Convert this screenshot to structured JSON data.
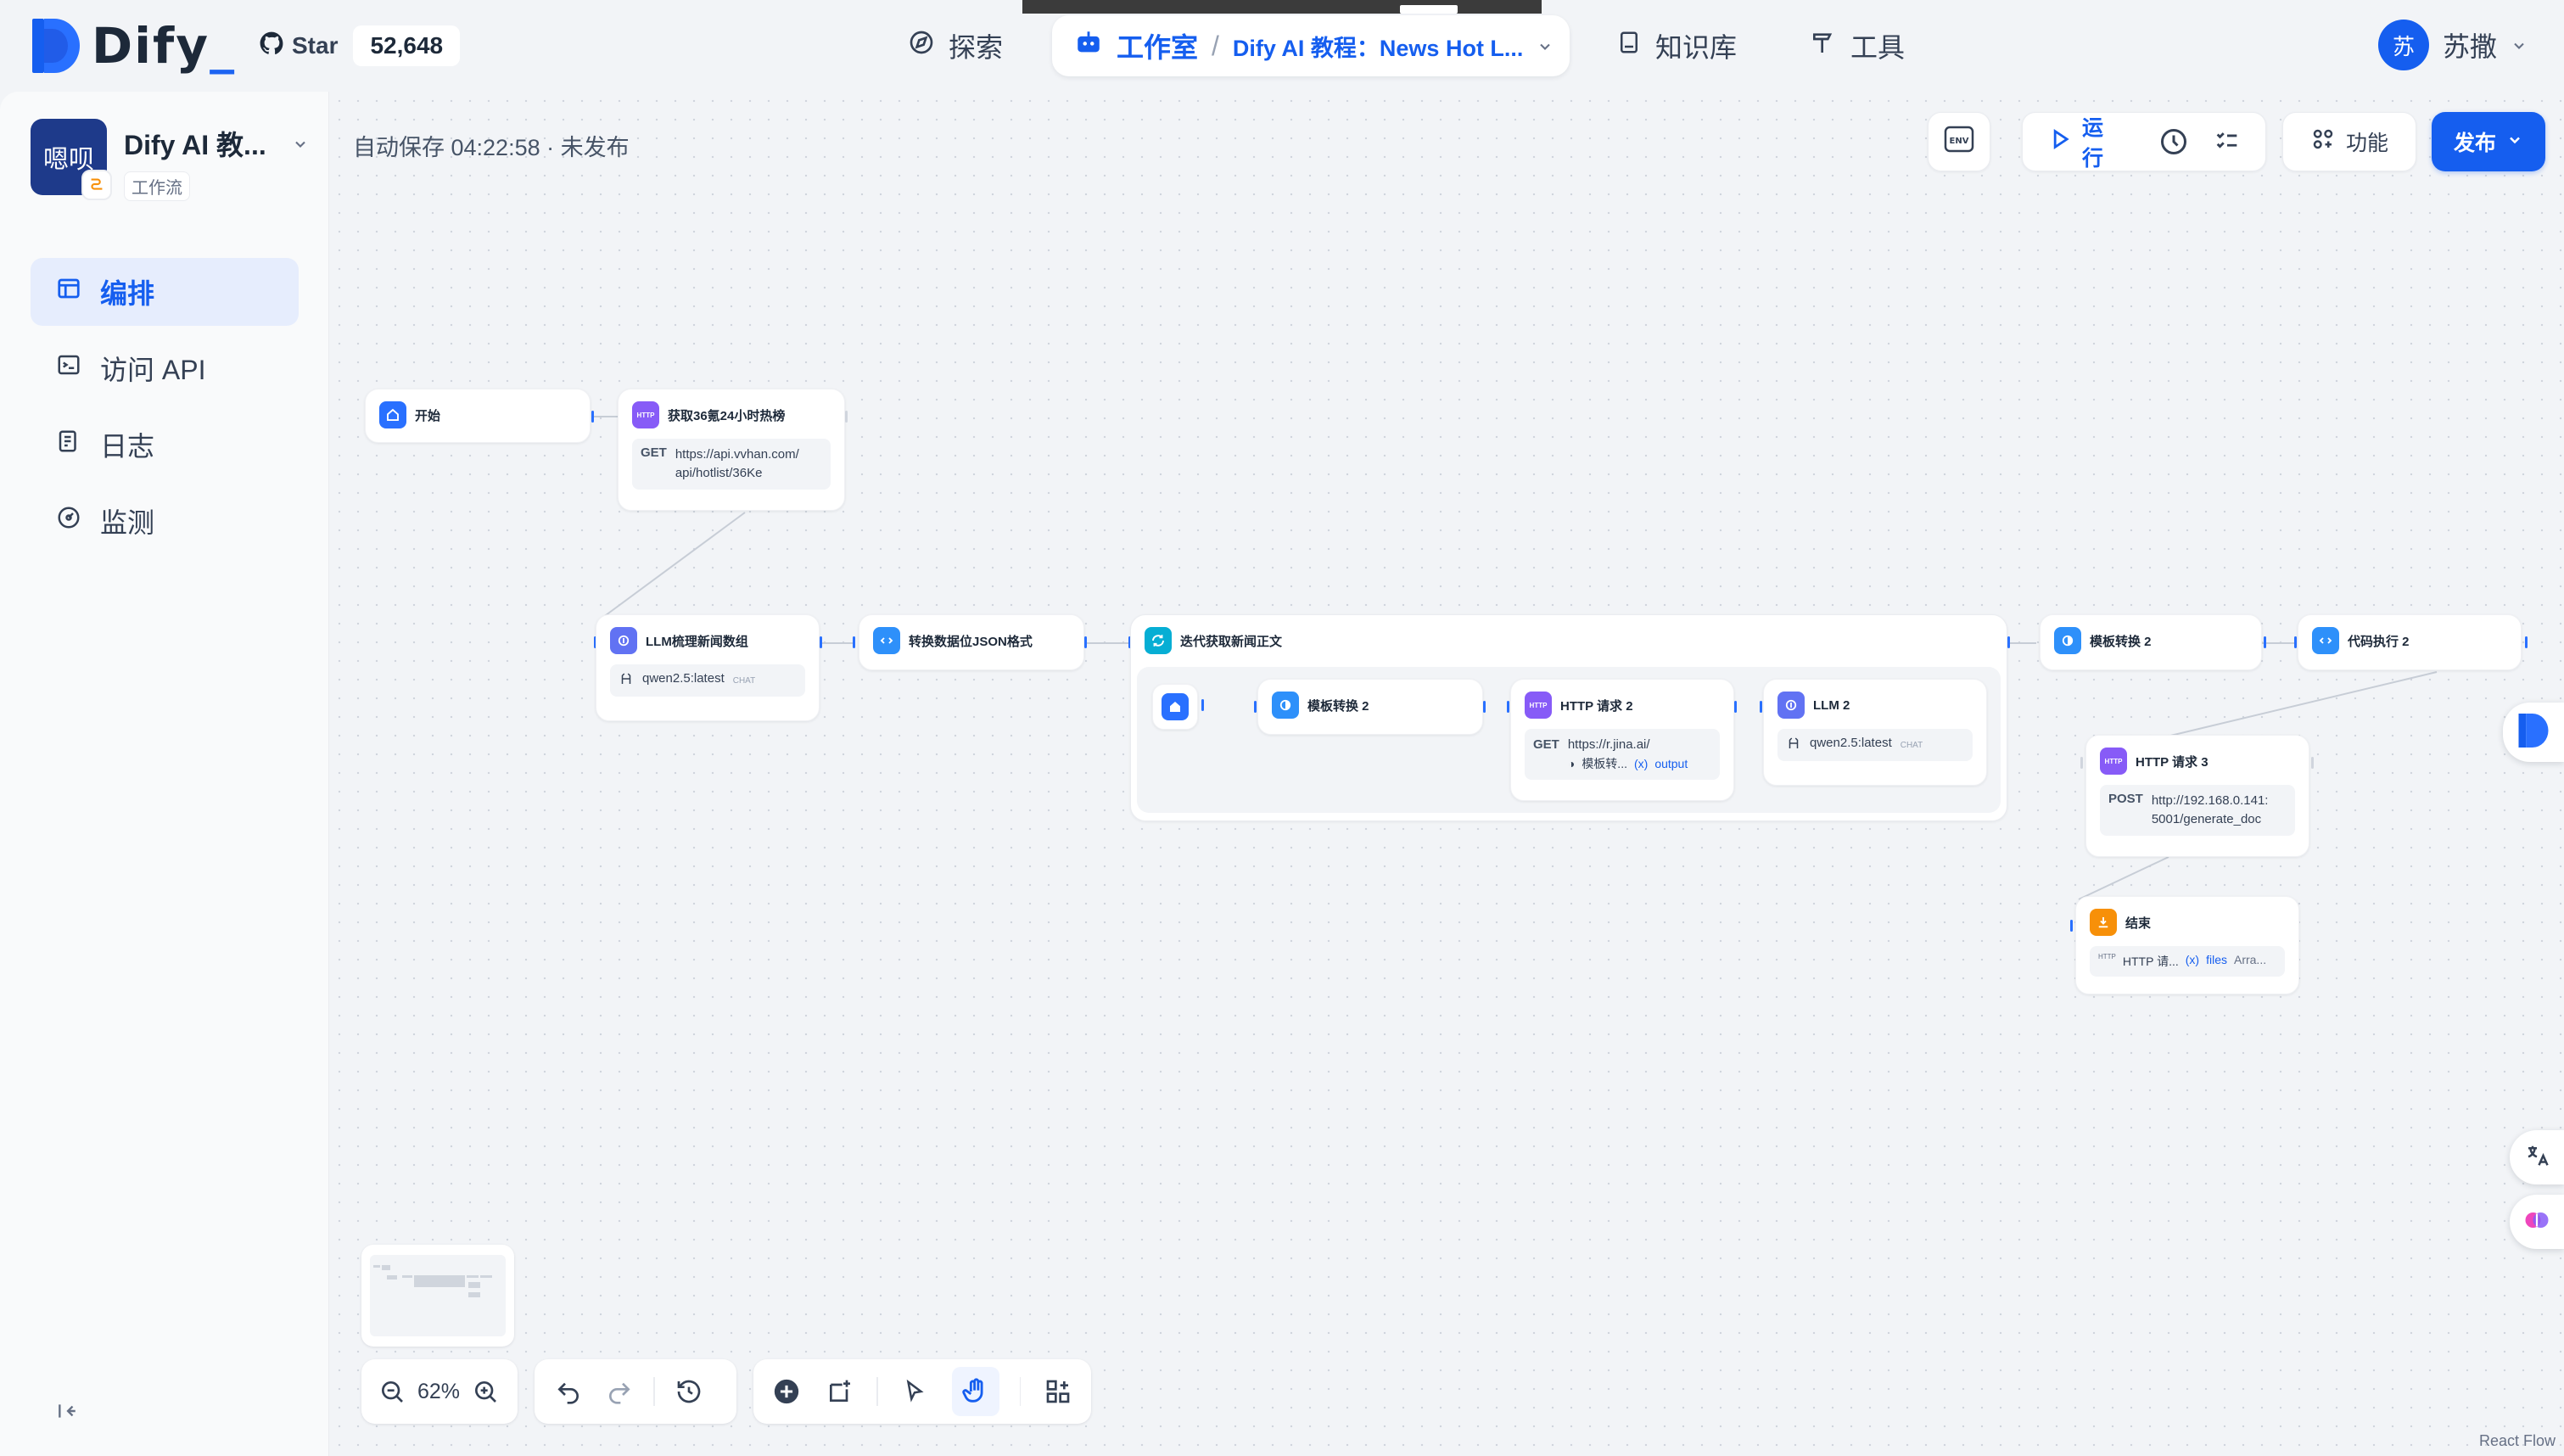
{
  "nav": {
    "logo_text": "Dify",
    "logo_suffix": "_",
    "github_label": "Star",
    "github_count": "52,648",
    "explore": "探索",
    "studio": "工作室",
    "studio_sep": "/",
    "current_app": "Dify AI 教程：News Hot L...",
    "knowledge": "知识库",
    "tools": "工具",
    "user_initial": "苏",
    "user_name": "苏撒"
  },
  "sidebar": {
    "app_icon_text": "嗯呗",
    "app_name": "Dify AI 教...",
    "app_type": "工作流",
    "items": [
      {
        "label": "编排",
        "icon": "layout-icon"
      },
      {
        "label": "访问 API",
        "icon": "terminal-icon"
      },
      {
        "label": "日志",
        "icon": "file-list-icon"
      },
      {
        "label": "监测",
        "icon": "dashboard-icon"
      }
    ]
  },
  "toolbar": {
    "autosave": "自动保存 04:22:58 · 未发布",
    "env_label": "ENV",
    "run_label": "运行",
    "features_label": "功能",
    "publish_label": "发布"
  },
  "nodes": {
    "start": {
      "title": "开始"
    },
    "http1": {
      "title": "获取36氪24小时热榜",
      "method": "GET",
      "url_line1": "https://api.vvhan.com/",
      "url_line2": "api/hotlist/36Ke",
      "icon_text": "HTTP"
    },
    "llm1": {
      "title": "LLM梳理新闻数组",
      "model": "qwen2.5:latest",
      "mode": "CHAT"
    },
    "code1": {
      "title": "转换数据位JSON格式"
    },
    "iter": {
      "title": "迭代获取新闻正文"
    },
    "tpl_inner": {
      "title": "模板转换 2"
    },
    "http2": {
      "title": "HTTP 请求 2",
      "method": "GET",
      "url": "https://r.jina.ai/",
      "var_src": "模板转...",
      "var_name": "output",
      "icon_text": "HTTP"
    },
    "llm2": {
      "title": "LLM 2",
      "model": "qwen2.5:latest",
      "mode": "CHAT"
    },
    "tpl2": {
      "title": "模板转换 2"
    },
    "code2": {
      "title": "代码执行 2"
    },
    "http3": {
      "title": "HTTP 请求 3",
      "method": "POST",
      "url_line1": "http://192.168.0.141:",
      "url_line2": "5001/generate_doc",
      "icon_text": "HTTP"
    },
    "end": {
      "title": "结束",
      "var_src": "HTTP 请...",
      "var_name": "files",
      "var_type": "Arra..."
    }
  },
  "controls": {
    "zoom": "62%"
  },
  "footer": {
    "react_flow": "React Flow"
  }
}
